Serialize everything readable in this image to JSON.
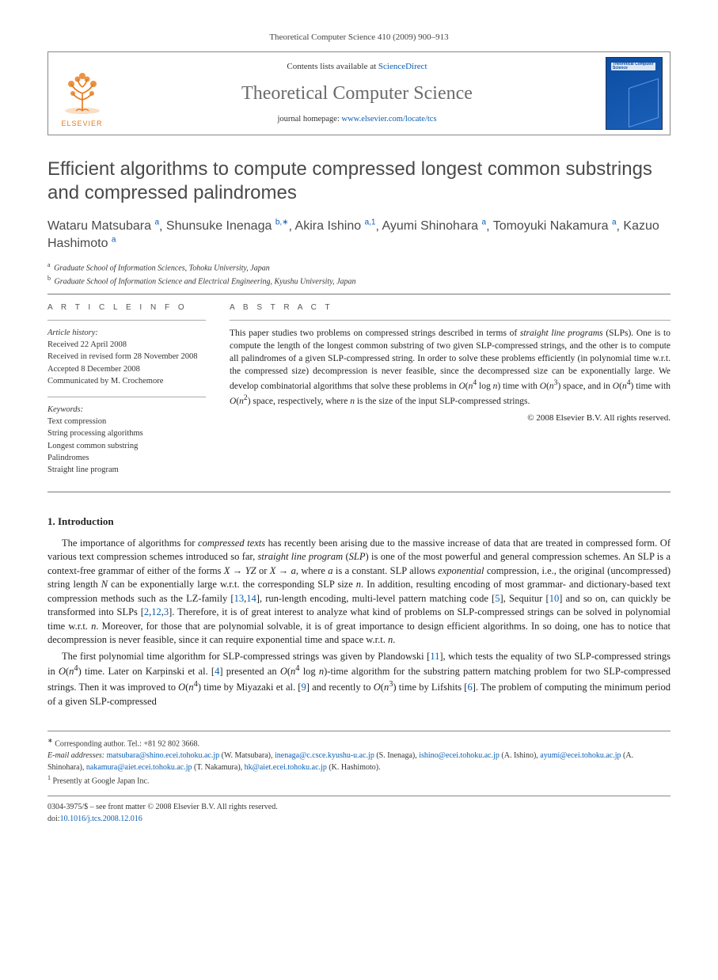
{
  "top_citation": "Theoretical Computer Science 410 (2009) 900–913",
  "header": {
    "publisher_label": "ELSEVIER",
    "contents_prefix": "Contents lists available at ",
    "contents_link": "ScienceDirect",
    "journal_name": "Theoretical Computer Science",
    "homepage_prefix": "journal homepage: ",
    "homepage_url": "www.elsevier.com/locate/tcs",
    "cover_text": "Theoretical Computer Science"
  },
  "title": "Efficient algorithms to compute compressed longest common substrings and compressed palindromes",
  "authors": [
    {
      "name": "Wataru Matsubara",
      "sup": "a"
    },
    {
      "name": "Shunsuke Inenaga",
      "sup": "b,∗"
    },
    {
      "name": "Akira Ishino",
      "sup": "a,1"
    },
    {
      "name": "Ayumi Shinohara",
      "sup": "a"
    },
    {
      "name": "Tomoyuki Nakamura",
      "sup": "a"
    },
    {
      "name": "Kazuo Hashimoto",
      "sup": "a"
    }
  ],
  "affiliations": {
    "a": "Graduate School of Information Sciences, Tohoku University, Japan",
    "b": "Graduate School of Information Science and Electrical Engineering, Kyushu University, Japan"
  },
  "info": {
    "label": "A R T I C L E   I N F O",
    "history_heading": "Article history:",
    "history": [
      "Received 22 April 2008",
      "Received in revised form 28 November 2008",
      "Accepted 8 December 2008",
      "Communicated by M. Crochemore"
    ],
    "keywords_heading": "Keywords:",
    "keywords": [
      "Text compression",
      "String processing algorithms",
      "Longest common substring",
      "Palindromes",
      "Straight line program"
    ]
  },
  "abstract": {
    "label": "A B S T R A C T",
    "text_html": "This paper studies two problems on compressed strings described in terms of <span class=\"italic\">straight line programs</span> (SLPs). One is to compute the length of the longest common substring of two given SLP-compressed strings, and the other is to compute all palindromes of a given SLP-compressed string. In order to solve these problems efficiently (in polynomial time w.r.t. the compressed size) decompression is never feasible, since the decompressed size can be exponentially large. We develop combinatorial algorithms that solve these problems in <span class=\"italic\">O</span>(<span class=\"italic\">n</span><sup>4</sup> log <span class=\"italic\">n</span>) time with <span class=\"italic\">O</span>(<span class=\"italic\">n</span><sup>3</sup>) space, and in <span class=\"italic\">O</span>(<span class=\"italic\">n</span><sup>4</sup>) time with <span class=\"italic\">O</span>(<span class=\"italic\">n</span><sup>2</sup>) space, respectively, where <span class=\"italic\">n</span> is the size of the input SLP-compressed strings.",
    "copyright": "© 2008 Elsevier B.V. All rights reserved."
  },
  "section1": {
    "heading": "1. Introduction",
    "p1_html": "The importance of algorithms for <span class=\"italic\">compressed texts</span> has recently been arising due to the massive increase of data that are treated in compressed form. Of various text compression schemes introduced so far, <span class=\"italic\">straight line program</span> (<span class=\"italic\">SLP</span>) is one of the most powerful and general compression schemes. An SLP is a context-free grammar of either of the forms <span class=\"italic\">X</span> → <span class=\"italic\">YZ</span> or <span class=\"italic\">X</span> → <span class=\"italic\">a</span>, where <span class=\"italic\">a</span> is a constant. SLP allows <span class=\"italic\">exponential</span> compression, i.e., the original (uncompressed) string length <span class=\"italic\">N</span> can be exponentially large w.r.t. the corresponding SLP size <span class=\"italic\">n</span>. In addition, resulting encoding of most grammar- and dictionary-based text compression methods such as the LZ-family [<a>13</a>,<a>14</a>], run-length encoding, multi-level pattern matching code [<a>5</a>], Sequitur [<a>10</a>] and so on, can quickly be transformed into SLPs [<a>2</a>,<a>12</a>,<a>3</a>]. Therefore, it is of great interest to analyze what kind of problems on SLP-compressed strings can be solved in polynomial time w.r.t. <span class=\"italic\">n</span>. Moreover, for those that are polynomial solvable, it is of great importance to design efficient algorithms. In so doing, one has to notice that decompression is never feasible, since it can require exponential time and space w.r.t. <span class=\"italic\">n</span>.",
    "p2_html": "The first polynomial time algorithm for SLP-compressed strings was given by Plandowski [<a>11</a>], which tests the equality of two SLP-compressed strings in <span class=\"italic\">O</span>(<span class=\"italic\">n</span><sup>4</sup>) time. Later on Karpinski et al. [<a>4</a>] presented an <span class=\"italic\">O</span>(<span class=\"italic\">n</span><sup>4</sup> log <span class=\"italic\">n</span>)-time algorithm for the substring pattern matching problem for two SLP-compressed strings. Then it was improved to <span class=\"italic\">O</span>(<span class=\"italic\">n</span><sup>4</sup>) time by Miyazaki et al. [<a>9</a>] and recently to <span class=\"italic\">O</span>(<span class=\"italic\">n</span><sup>3</sup>) time by Lifshits [<a>6</a>]. The problem of computing the minimum period of a given SLP-compressed"
  },
  "footnotes": {
    "corresponding": "Corresponding author. Tel.: +81 92 802 3668.",
    "emails_label": "E-mail addresses:",
    "emails": [
      {
        "addr": "matsubara@shino.ecei.tohoku.ac.jp",
        "who": "(W. Matsubara)"
      },
      {
        "addr": "inenaga@c.csce.kyushu-u.ac.jp",
        "who": "(S. Inenaga)"
      },
      {
        "addr": "ishino@ecei.tohoku.ac.jp",
        "who": "(A. Ishino)"
      },
      {
        "addr": "ayumi@ecei.tohoku.ac.jp",
        "who": "(A. Shinohara)"
      },
      {
        "addr": "nakamura@aiet.ecei.tohoku.ac.jp",
        "who": "(T. Nakamura)"
      },
      {
        "addr": "hk@aiet.ecei.tohoku.ac.jp",
        "who": "(K. Hashimoto)"
      }
    ],
    "note1": "Presently at Google Japan Inc."
  },
  "bottom": {
    "issn_line": "0304-3975/$ – see front matter © 2008 Elsevier B.V. All rights reserved.",
    "doi_label": "doi:",
    "doi": "10.1016/j.tcs.2008.12.016"
  }
}
